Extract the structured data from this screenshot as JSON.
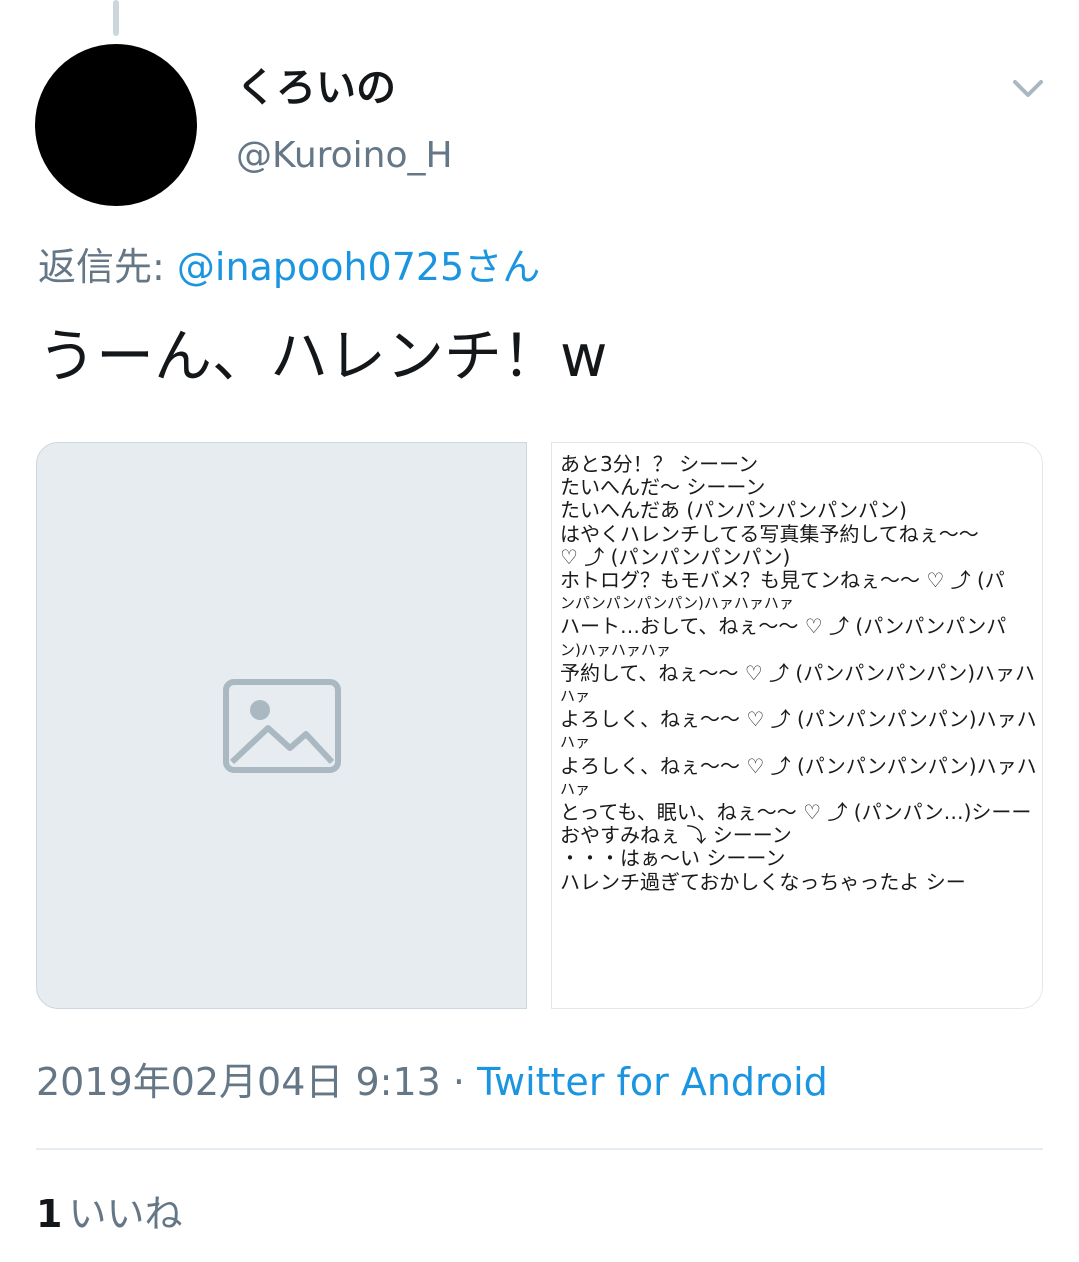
{
  "tweet": {
    "display_name": "くろいの",
    "handle": "@Kuroino_H",
    "reply_prefix": "返信先: ",
    "reply_to": "@inapooh0725さん",
    "text": "うーん、ハレンチ！w",
    "timestamp": "2019年02月04日 9:13",
    "separator": " · ",
    "source": "Twitter for Android",
    "like_count": "1",
    "like_label": "いいね"
  },
  "image_note": {
    "lines": [
      "あと3分！？ シーーン",
      "たいへんだ〜 シーーン",
      "たいへんだあ (パンパンパンパンパン)",
      "はやくハレンチしてる写真集予約してねぇ〜〜",
      "♡ ⤴ (パンパンパンパン)",
      "ホトログ？もモバメ？も見てンねぇ〜〜 ♡ ⤴ (パ",
      "ンパンパンパンパン)ハァハァハァ",
      "ハート…おして、ねぇ〜〜 ♡ ⤴ (パンパンパンパ",
      "ン)ハァハァハァ",
      "予約して、ねぇ〜〜 ♡ ⤴ (パンパンパンパン)ハァハ",
      "ハァ",
      "よろしく、ねぇ〜〜 ♡ ⤴ (パンパンパンパン)ハァハ",
      "ハァ",
      "よろしく、ねぇ〜〜 ♡ ⤴ (パンパンパンパン)ハァハ",
      "ハァ",
      "とっても、眠い、ねぇ〜〜 ♡ ⤴ (パンパン…)シーー",
      "おやすみねぇ ⤵ シーーン",
      "・・・はぁ〜い シーーン",
      "ハレンチ過ぎておかしくなっちゃったよ シー"
    ]
  },
  "colors": {
    "text": "#14171a",
    "secondary": "#657786",
    "link": "#1b95e0",
    "divider": "#e6ecf0"
  }
}
